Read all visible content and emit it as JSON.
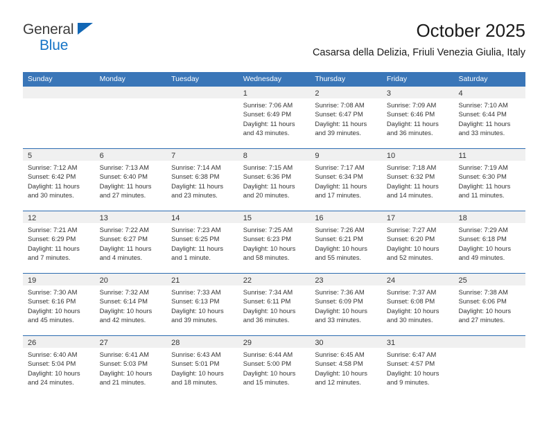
{
  "brand": {
    "name_part1": "General",
    "name_part2": "Blue",
    "triangle_icon": "triangle-icon",
    "accent_color": "#1473c6"
  },
  "header": {
    "title": "October 2025",
    "subtitle": "Casarsa della Delizia, Friuli Venezia Giulia, Italy"
  },
  "theme": {
    "header_blue": "#3a76b8",
    "row_border_blue": "#2a6ab0",
    "day_band_grey": "#f0f0f0"
  },
  "weekdays": [
    "Sunday",
    "Monday",
    "Tuesday",
    "Wednesday",
    "Thursday",
    "Friday",
    "Saturday"
  ],
  "weeks": [
    [
      {
        "day": "",
        "lines": []
      },
      {
        "day": "",
        "lines": []
      },
      {
        "day": "",
        "lines": []
      },
      {
        "day": "1",
        "lines": [
          "Sunrise: 7:06 AM",
          "Sunset: 6:49 PM",
          "Daylight: 11 hours",
          "and 43 minutes."
        ]
      },
      {
        "day": "2",
        "lines": [
          "Sunrise: 7:08 AM",
          "Sunset: 6:47 PM",
          "Daylight: 11 hours",
          "and 39 minutes."
        ]
      },
      {
        "day": "3",
        "lines": [
          "Sunrise: 7:09 AM",
          "Sunset: 6:46 PM",
          "Daylight: 11 hours",
          "and 36 minutes."
        ]
      },
      {
        "day": "4",
        "lines": [
          "Sunrise: 7:10 AM",
          "Sunset: 6:44 PM",
          "Daylight: 11 hours",
          "and 33 minutes."
        ]
      }
    ],
    [
      {
        "day": "5",
        "lines": [
          "Sunrise: 7:12 AM",
          "Sunset: 6:42 PM",
          "Daylight: 11 hours",
          "and 30 minutes."
        ]
      },
      {
        "day": "6",
        "lines": [
          "Sunrise: 7:13 AM",
          "Sunset: 6:40 PM",
          "Daylight: 11 hours",
          "and 27 minutes."
        ]
      },
      {
        "day": "7",
        "lines": [
          "Sunrise: 7:14 AM",
          "Sunset: 6:38 PM",
          "Daylight: 11 hours",
          "and 23 minutes."
        ]
      },
      {
        "day": "8",
        "lines": [
          "Sunrise: 7:15 AM",
          "Sunset: 6:36 PM",
          "Daylight: 11 hours",
          "and 20 minutes."
        ]
      },
      {
        "day": "9",
        "lines": [
          "Sunrise: 7:17 AM",
          "Sunset: 6:34 PM",
          "Daylight: 11 hours",
          "and 17 minutes."
        ]
      },
      {
        "day": "10",
        "lines": [
          "Sunrise: 7:18 AM",
          "Sunset: 6:32 PM",
          "Daylight: 11 hours",
          "and 14 minutes."
        ]
      },
      {
        "day": "11",
        "lines": [
          "Sunrise: 7:19 AM",
          "Sunset: 6:30 PM",
          "Daylight: 11 hours",
          "and 11 minutes."
        ]
      }
    ],
    [
      {
        "day": "12",
        "lines": [
          "Sunrise: 7:21 AM",
          "Sunset: 6:29 PM",
          "Daylight: 11 hours",
          "and 7 minutes."
        ]
      },
      {
        "day": "13",
        "lines": [
          "Sunrise: 7:22 AM",
          "Sunset: 6:27 PM",
          "Daylight: 11 hours",
          "and 4 minutes."
        ]
      },
      {
        "day": "14",
        "lines": [
          "Sunrise: 7:23 AM",
          "Sunset: 6:25 PM",
          "Daylight: 11 hours",
          "and 1 minute."
        ]
      },
      {
        "day": "15",
        "lines": [
          "Sunrise: 7:25 AM",
          "Sunset: 6:23 PM",
          "Daylight: 10 hours",
          "and 58 minutes."
        ]
      },
      {
        "day": "16",
        "lines": [
          "Sunrise: 7:26 AM",
          "Sunset: 6:21 PM",
          "Daylight: 10 hours",
          "and 55 minutes."
        ]
      },
      {
        "day": "17",
        "lines": [
          "Sunrise: 7:27 AM",
          "Sunset: 6:20 PM",
          "Daylight: 10 hours",
          "and 52 minutes."
        ]
      },
      {
        "day": "18",
        "lines": [
          "Sunrise: 7:29 AM",
          "Sunset: 6:18 PM",
          "Daylight: 10 hours",
          "and 49 minutes."
        ]
      }
    ],
    [
      {
        "day": "19",
        "lines": [
          "Sunrise: 7:30 AM",
          "Sunset: 6:16 PM",
          "Daylight: 10 hours",
          "and 45 minutes."
        ]
      },
      {
        "day": "20",
        "lines": [
          "Sunrise: 7:32 AM",
          "Sunset: 6:14 PM",
          "Daylight: 10 hours",
          "and 42 minutes."
        ]
      },
      {
        "day": "21",
        "lines": [
          "Sunrise: 7:33 AM",
          "Sunset: 6:13 PM",
          "Daylight: 10 hours",
          "and 39 minutes."
        ]
      },
      {
        "day": "22",
        "lines": [
          "Sunrise: 7:34 AM",
          "Sunset: 6:11 PM",
          "Daylight: 10 hours",
          "and 36 minutes."
        ]
      },
      {
        "day": "23",
        "lines": [
          "Sunrise: 7:36 AM",
          "Sunset: 6:09 PM",
          "Daylight: 10 hours",
          "and 33 minutes."
        ]
      },
      {
        "day": "24",
        "lines": [
          "Sunrise: 7:37 AM",
          "Sunset: 6:08 PM",
          "Daylight: 10 hours",
          "and 30 minutes."
        ]
      },
      {
        "day": "25",
        "lines": [
          "Sunrise: 7:38 AM",
          "Sunset: 6:06 PM",
          "Daylight: 10 hours",
          "and 27 minutes."
        ]
      }
    ],
    [
      {
        "day": "26",
        "lines": [
          "Sunrise: 6:40 AM",
          "Sunset: 5:04 PM",
          "Daylight: 10 hours",
          "and 24 minutes."
        ]
      },
      {
        "day": "27",
        "lines": [
          "Sunrise: 6:41 AM",
          "Sunset: 5:03 PM",
          "Daylight: 10 hours",
          "and 21 minutes."
        ]
      },
      {
        "day": "28",
        "lines": [
          "Sunrise: 6:43 AM",
          "Sunset: 5:01 PM",
          "Daylight: 10 hours",
          "and 18 minutes."
        ]
      },
      {
        "day": "29",
        "lines": [
          "Sunrise: 6:44 AM",
          "Sunset: 5:00 PM",
          "Daylight: 10 hours",
          "and 15 minutes."
        ]
      },
      {
        "day": "30",
        "lines": [
          "Sunrise: 6:45 AM",
          "Sunset: 4:58 PM",
          "Daylight: 10 hours",
          "and 12 minutes."
        ]
      },
      {
        "day": "31",
        "lines": [
          "Sunrise: 6:47 AM",
          "Sunset: 4:57 PM",
          "Daylight: 10 hours",
          "and 9 minutes."
        ]
      },
      {
        "day": "",
        "lines": []
      }
    ]
  ]
}
